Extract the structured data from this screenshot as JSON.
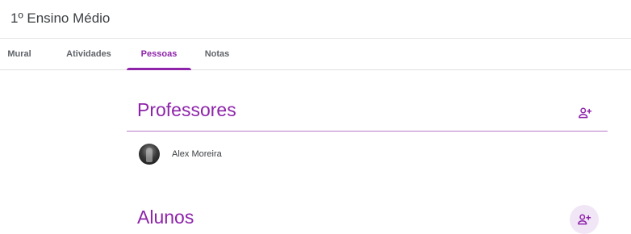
{
  "header": {
    "title": "1º Ensino Médio"
  },
  "tabs": [
    {
      "label": "Mural",
      "active": false
    },
    {
      "label": "Atividades",
      "active": false
    },
    {
      "label": "Pessoas",
      "active": true
    },
    {
      "label": "Notas",
      "active": false
    }
  ],
  "teachers": {
    "title": "Professores",
    "invite_icon": "person-add-icon",
    "people": [
      {
        "name": "Alex Moreira",
        "avatar": "profile-photo"
      }
    ]
  },
  "students": {
    "title": "Alunos",
    "invite_icon": "person-add-icon"
  },
  "colors": {
    "accent": "#8e24aa",
    "accent_light": "#f1e6f6",
    "divider": "#b77ac8",
    "text": "#3c4043"
  }
}
